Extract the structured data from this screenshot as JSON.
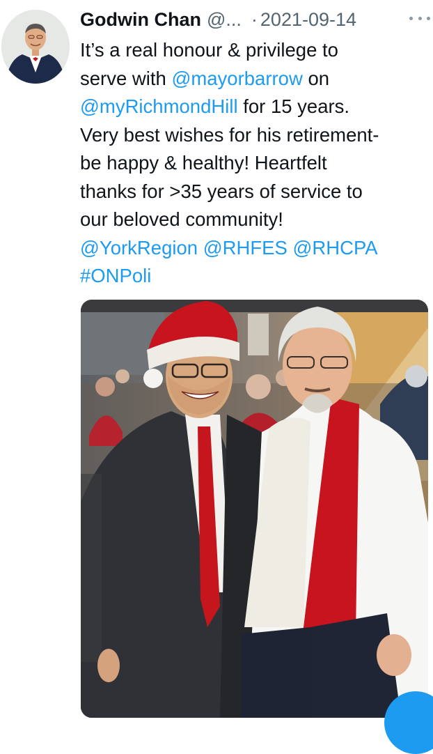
{
  "tweet": {
    "author_name": "Godwin Chan",
    "handle": "@...",
    "separator": "·",
    "date": "2021-09-14",
    "lines": [
      [
        {
          "t": "It’s a real honour & privilege to",
          "link": false
        }
      ],
      [
        {
          "t": "serve with ",
          "link": false
        },
        {
          "t": "@mayorbarrow",
          "link": true
        },
        {
          "t": " on",
          "link": false
        }
      ],
      [
        {
          "t": "@myRichmondHill",
          "link": true
        },
        {
          "t": " for 15 years.",
          "link": false
        }
      ],
      [
        {
          "t": "Very best wishes for his retirement-",
          "link": false
        }
      ],
      [
        {
          "t": "be happy & healthy! Heartfelt",
          "link": false
        }
      ],
      [
        {
          "t": "thanks for >35 years of service to",
          "link": false
        }
      ],
      [
        {
          "t": "our beloved community!",
          "link": false
        }
      ],
      [
        {
          "t": "@YorkRegion",
          "link": true
        },
        {
          "t": " ",
          "link": false
        },
        {
          "t": "@RHFES",
          "link": true
        },
        {
          "t": " ",
          "link": false
        },
        {
          "t": "@RHCPA",
          "link": true
        }
      ],
      [
        {
          "t": "#ONPoli",
          "link": true
        }
      ]
    ]
  },
  "colors": {
    "link": "#1d9bf0",
    "text": "#0f1419",
    "muted": "#536471"
  },
  "icons": {
    "more": "more-dots-icon",
    "compose": "compose-fab-icon"
  }
}
